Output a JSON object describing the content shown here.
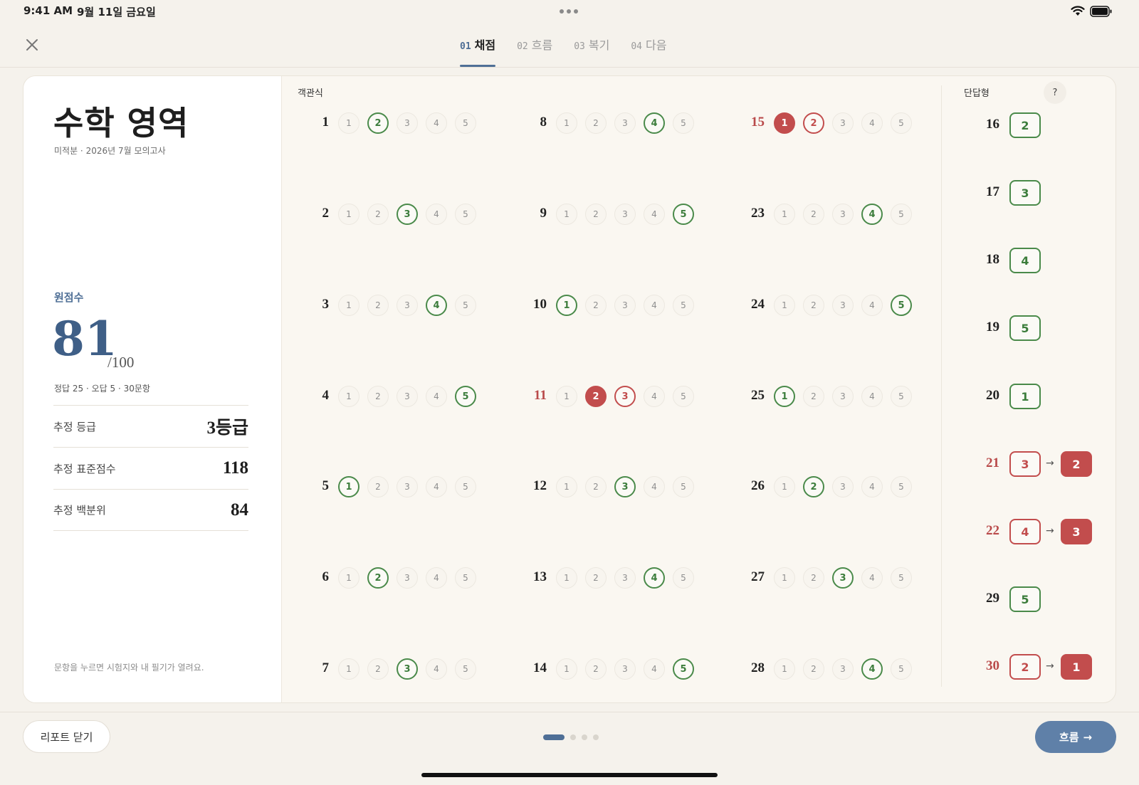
{
  "status_bar": {
    "time": "9:41 AM",
    "date": "9월 11일 금요일"
  },
  "tabs": [
    {
      "num": "01",
      "label": "채점",
      "active": true
    },
    {
      "num": "02",
      "label": "흐름",
      "active": false
    },
    {
      "num": "03",
      "label": "복기",
      "active": false
    },
    {
      "num": "04",
      "label": "다음",
      "active": false
    }
  ],
  "summary": {
    "title": "수학 영역",
    "subtitle": "미적분 · 2026년 7월 모의고사",
    "raw_label": "원점수",
    "raw_score": "81",
    "raw_max": "/100",
    "detail": "정답 25 · 오답 5 · 30문항",
    "stats": [
      {
        "label": "추정 등급",
        "value": "3등급"
      },
      {
        "label": "추정 표준점수",
        "value": "118"
      },
      {
        "label": "추정 백분위",
        "value": "84"
      }
    ],
    "hint": "문항을 누르면 시험지와 내 필기가 열려요."
  },
  "multiple_choice": {
    "label": "객관식",
    "columns": [
      [
        {
          "num": "1",
          "answer": 2
        },
        {
          "num": "2",
          "answer": 3
        },
        {
          "num": "3",
          "answer": 4
        },
        {
          "num": "4",
          "answer": 5
        },
        {
          "num": "5",
          "answer": 1
        },
        {
          "num": "6",
          "answer": 2
        },
        {
          "num": "7",
          "answer": 3
        }
      ],
      [
        {
          "num": "8",
          "answer": 4
        },
        {
          "num": "9",
          "answer": 5
        },
        {
          "num": "10",
          "answer": 1
        },
        {
          "num": "11",
          "answer": 3,
          "marked": 2
        },
        {
          "num": "12",
          "answer": 3
        },
        {
          "num": "13",
          "answer": 4
        },
        {
          "num": "14",
          "answer": 5
        }
      ],
      [
        {
          "num": "15",
          "answer": 2,
          "marked": 1
        },
        {
          "num": "23",
          "answer": 4
        },
        {
          "num": "24",
          "answer": 5
        },
        {
          "num": "25",
          "answer": 1
        },
        {
          "num": "26",
          "answer": 2
        },
        {
          "num": "27",
          "answer": 3
        },
        {
          "num": "28",
          "answer": 4
        }
      ]
    ]
  },
  "short_answer": {
    "label": "단답형",
    "help": "?",
    "arrow": "→",
    "items": [
      {
        "num": "16",
        "answer": "2"
      },
      {
        "num": "17",
        "answer": "3"
      },
      {
        "num": "18",
        "answer": "4"
      },
      {
        "num": "19",
        "answer": "5"
      },
      {
        "num": "20",
        "answer": "1"
      },
      {
        "num": "21",
        "answer": "3",
        "marked": "2"
      },
      {
        "num": "22",
        "answer": "4",
        "marked": "3"
      },
      {
        "num": "29",
        "answer": "5"
      },
      {
        "num": "30",
        "answer": "2",
        "marked": "1"
      }
    ]
  },
  "footer": {
    "close_label": "리포트 닫기",
    "next_label": "흐름",
    "next_arrow": "→",
    "pager": {
      "current": 1,
      "total": 4
    }
  },
  "colors": {
    "accent": "#4f6f96",
    "correct": "#4a8a4a",
    "wrong": "#c24d4d"
  }
}
